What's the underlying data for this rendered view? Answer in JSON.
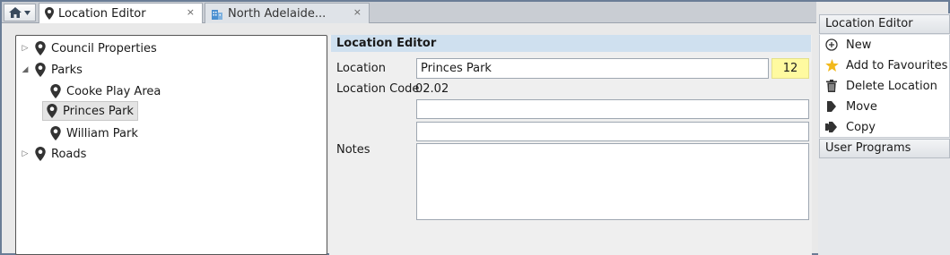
{
  "tabs": [
    {
      "label": "Location Editor",
      "icon": "map-pin-icon",
      "close": "×"
    },
    {
      "label": "North Adelaide...",
      "icon": "building-icon",
      "close": "×"
    }
  ],
  "tree": {
    "items": [
      {
        "label": "Council Properties",
        "expander": "▷"
      },
      {
        "label": "Parks",
        "expander": "◢"
      },
      {
        "label": "Cooke Play Area"
      },
      {
        "label": "Princes Park"
      },
      {
        "label": "William Park"
      },
      {
        "label": "Roads",
        "expander": "▷"
      }
    ]
  },
  "editor": {
    "title": "Location Editor",
    "location_label": "Location",
    "location_value": "Princes Park",
    "location_count": "12",
    "code_label": "Location Code",
    "code_value": "02.02",
    "extra1_value": "",
    "extra2_value": "",
    "notes_label": "Notes",
    "notes_value": ""
  },
  "panel": {
    "section_title": "Location Editor",
    "actions": [
      {
        "label": "New",
        "icon": "plus-circle-icon"
      },
      {
        "label": "Add to Favourites",
        "icon": "star-icon"
      },
      {
        "label": "Delete Location",
        "icon": "trash-icon"
      },
      {
        "label": "Move",
        "icon": "move-icon"
      },
      {
        "label": "Copy",
        "icon": "copy-icon"
      }
    ],
    "user_programs_title": "User Programs"
  },
  "colors": {
    "accent_header": "#cfe0ef",
    "badge": "#fffaa0",
    "star": "#f2b91c",
    "frame": "#6a7d96"
  }
}
